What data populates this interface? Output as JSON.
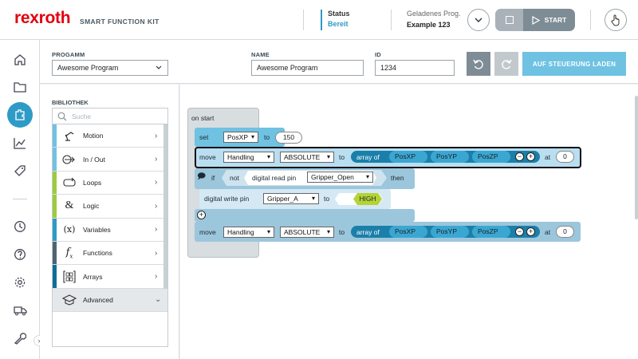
{
  "header": {
    "logo": "rexroth",
    "kit_label": "SMART FUNCTION KIT",
    "status_label": "Status",
    "status_value": "Bereit",
    "loaded_label": "Geladenes Prog.",
    "loaded_value": "Example 123",
    "start_label": "START"
  },
  "nav": {
    "items": [
      "home-icon",
      "folder-icon",
      "program-icon",
      "chart-icon",
      "tag-icon",
      "history-icon",
      "help-icon",
      "settings-icon",
      "truck-icon",
      "wrench-icon"
    ]
  },
  "toolbar": {
    "program_label": "PROGAMM",
    "program_value": "Awesome Program",
    "name_label": "NAME",
    "name_value": "Awesome Program",
    "id_label": "ID",
    "id_value": "1234",
    "load_button": "AUF STEUERUNG LADEN"
  },
  "library": {
    "title": "BIBLIOTHEK",
    "search_placeholder": "Suche",
    "items": [
      {
        "label": "Motion",
        "icon": "robot-arm-icon",
        "color": "#6fc2e2"
      },
      {
        "label": "In / Out",
        "icon": "io-icon",
        "color": "#6fc2e2"
      },
      {
        "label": "Loops",
        "icon": "loop-icon",
        "color": "#9ccb3d"
      },
      {
        "label": "Logic",
        "icon": "logic-icon",
        "color": "#9ccb3d"
      },
      {
        "label": "Variables",
        "icon": "variables-icon",
        "color": "#2e9bc6"
      },
      {
        "label": "Functions",
        "icon": "function-icon",
        "color": "#506470"
      },
      {
        "label": "Arrays",
        "icon": "array-icon",
        "color": "#0f6e99"
      },
      {
        "label": "Advanced",
        "icon": "graduation-cap-icon",
        "color": ""
      }
    ]
  },
  "blocks": {
    "on_start": "on start",
    "set": "set",
    "set_var": "PosXP",
    "to": "to",
    "set_value": "150",
    "move": "move",
    "handling": "Handling",
    "absolute": "ABSOLUTE",
    "array_of": "array of",
    "posx": "PosXP",
    "posy": "PosYP",
    "posz": "PosZP",
    "at": "at",
    "at_value": "0",
    "if": "if",
    "not": "not",
    "digital_read_pin": "digital read pin",
    "read_pin_value": "Gripper_Open",
    "then": "then",
    "digital_write_pin": "digital write pin",
    "write_pin_value": "Gripper_A",
    "high": "HIGH",
    "move2": "move",
    "handling2": "Handling",
    "absolute2": "ABSOLUTE",
    "to2": "to",
    "array_of2": "array of",
    "posx2": "PosXP",
    "posy2": "PosYP",
    "posz2": "PosZP",
    "at2": "at",
    "at_value2": "0"
  }
}
